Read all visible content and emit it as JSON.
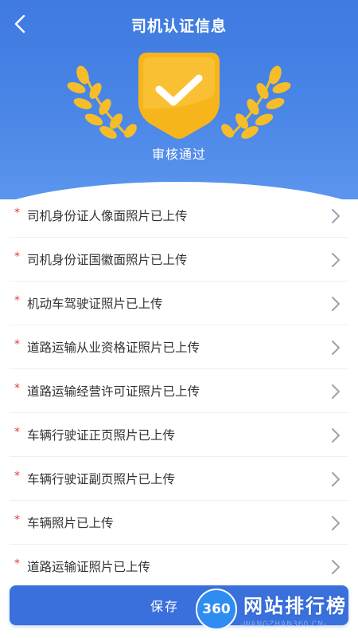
{
  "header": {
    "title": "司机认证信息",
    "back_icon": "chevron-left-icon"
  },
  "status": {
    "text": "审核通过",
    "badge_icon": "checkmark-shield-icon",
    "badge_color": "#f7b51c"
  },
  "items": [
    {
      "label": "司机身份证人像面照片已上传"
    },
    {
      "label": "司机身份证国徽面照片已上传"
    },
    {
      "label": "机动车驾驶证照片已上传"
    },
    {
      "label": "道路运输从业资格证照片已上传"
    },
    {
      "label": "道路运输经营许可证照片已上传"
    },
    {
      "label": "车辆行驶证正页照片已上传"
    },
    {
      "label": "车辆行驶证副页照片已上传"
    },
    {
      "label": "车辆照片已上传"
    },
    {
      "label": "道路运输证照片已上传"
    }
  ],
  "required_mark": "*",
  "save": {
    "label": "保存"
  },
  "watermark": {
    "badge": "360",
    "text": "网站排行榜",
    "sub": "-WANGZHAN360.CN-"
  },
  "colors": {
    "primary": "#3a70dc",
    "required": "#e6373a"
  }
}
